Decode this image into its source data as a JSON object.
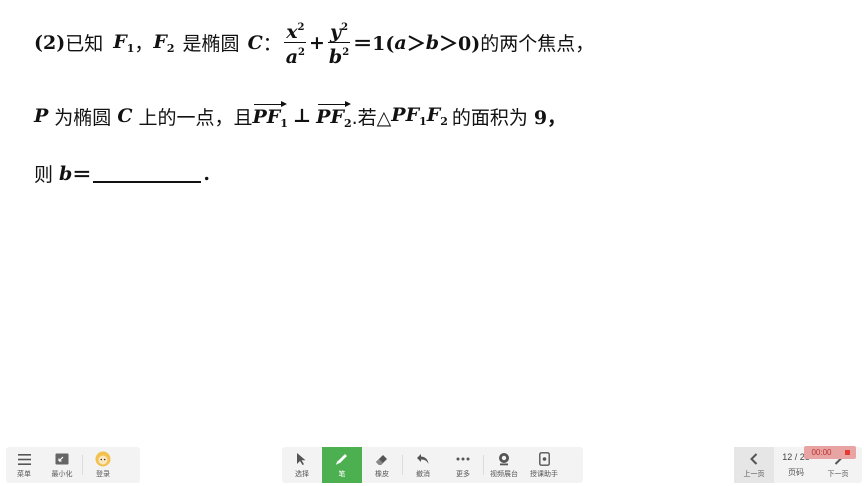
{
  "problem": {
    "l1_prefix": "(2)",
    "l1_cjk1": "已知",
    "F": "F",
    "sub1": "1",
    "sub2": "2",
    "comma": "，",
    "l1_cjk2": "是椭圆",
    "C": "C",
    "colon": "：",
    "x": "x",
    "y": "y",
    "a": "a",
    "b": "b",
    "sq": "2",
    "plus": "+",
    "eq_one": "＝1(",
    "gt": "＞",
    "zero_close": "＞0)",
    "l1_cjk3": "的两个焦点，",
    "P": "P",
    "l2_cjk1": "为椭圆",
    "l2_cjk2": "上的一点，且",
    "perp": "⊥",
    "l2_cjk3": ".若△",
    "l2_cjk4": "的面积为",
    "nine": "9，",
    "l3_cjk": "则",
    "eq": "＝",
    "period": "."
  },
  "toolbar": {
    "menu": "菜单",
    "minimize": "最小化",
    "login": "登录",
    "select": "选择",
    "pen": "笔",
    "eraser": "橡皮",
    "undo": "撤消",
    "more": "更多",
    "video_booth": "视频展台",
    "assistant": "授课助手",
    "prev": "上一页",
    "page_label": "页码",
    "page_num": "12 / 28",
    "next": "下一页"
  },
  "recorder": {
    "time": "00:00"
  },
  "colors": {
    "accent": "#4caf50",
    "toolbar_bg": "#f3f3f3",
    "record": "#e53935"
  }
}
